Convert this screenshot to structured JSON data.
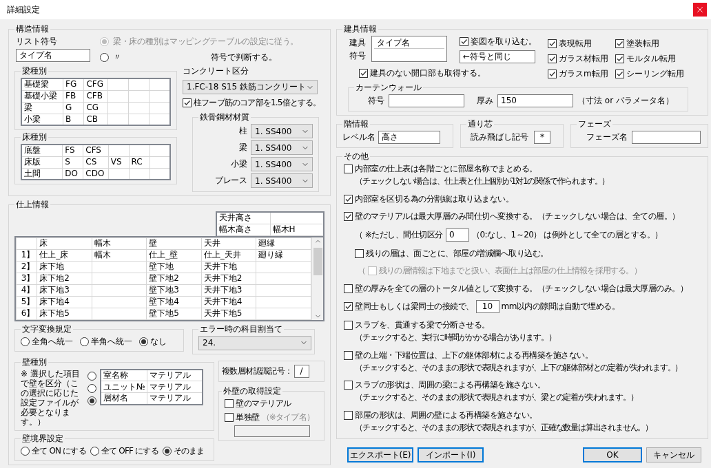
{
  "window": {
    "title": "詳細設定"
  },
  "structure": {
    "title": "構造情報",
    "list_symbol": {
      "label": "リスト符号",
      "value": "タイプ名"
    },
    "mapping_options": [
      {
        "label": "梁・床の種別はマッピングテーブルの設定に従う。",
        "selected": true,
        "disabled": true
      },
      {
        "prefix": "〃",
        "label": "符号で判断する。",
        "selected": false,
        "disabled": false
      }
    ],
    "beam_types": {
      "title": "梁種別",
      "rows": [
        [
          "基礎梁",
          "FG",
          "CFG"
        ],
        [
          "基礎小梁",
          "FB",
          "CFB"
        ],
        [
          "梁",
          "G",
          "CG"
        ],
        [
          "小梁",
          "B",
          "CB"
        ]
      ]
    },
    "floor_types": {
      "title": "床種別",
      "rows": [
        [
          "底盤",
          "FS",
          "CFS"
        ],
        [
          "床版",
          "S",
          "CS",
          "VS",
          "RC"
        ],
        [
          "土間",
          "DO",
          "CDO"
        ]
      ]
    },
    "concrete": {
      "label": "コンクリート区分",
      "value": "1.FC-18 S15 鉄筋コンクリート"
    },
    "hoop": {
      "label": "柱フープ筋のコア部を1.5倍とする。",
      "checked": true
    },
    "steel": {
      "title": "鉄骨鋼材材質",
      "rows": [
        {
          "label": "柱",
          "value": "1. SS400"
        },
        {
          "label": "梁",
          "value": "1. SS400"
        },
        {
          "label": "小梁",
          "value": "1. SS400"
        },
        {
          "label": "ブレース",
          "value": "1. SS400"
        }
      ]
    }
  },
  "finish": {
    "title": "仕上情報",
    "heights": [
      {
        "label": "天井高さ"
      },
      {
        "label": "幅木高さ",
        "value": "幅木H"
      }
    ],
    "columns": [
      "床",
      "幅木",
      "壁",
      "天井",
      "廻縁"
    ],
    "rows": [
      {
        "index": "1】",
        "cells": [
          "仕上_床",
          "幅木",
          "仕上_壁",
          "仕上_天井",
          "廻り縁"
        ]
      },
      {
        "index": "2】",
        "cells": [
          "床下地",
          null,
          "壁下地",
          "天井下地",
          null
        ]
      },
      {
        "index": "3】",
        "cells": [
          "床下地2",
          null,
          "壁下地2",
          "天井下地2",
          null
        ]
      },
      {
        "index": "4】",
        "cells": [
          "床下地3",
          null,
          "壁下地3",
          "天井下地3",
          null
        ]
      },
      {
        "index": "5】",
        "cells": [
          "床下地4",
          null,
          "壁下地4",
          "天井下地4",
          null
        ]
      },
      {
        "index": "6】",
        "cells": [
          "床下地5",
          null,
          "壁下地5",
          "天井下地5",
          null
        ]
      }
    ],
    "char_conversion": {
      "title": "文字変換規定",
      "options": [
        {
          "label": "全角へ統一",
          "selected": false
        },
        {
          "label": "半角へ統一",
          "selected": false
        },
        {
          "label": "なし",
          "selected": true
        }
      ]
    },
    "error_subject": {
      "title": "エラー時の科目割当て",
      "value": "24."
    },
    "wall_types": {
      "title": "壁種別",
      "note": "※ 選択した項目で壁を区分（この選択に応じた設定ファイルが必要となります。）",
      "rows": [
        {
          "name": "室名称",
          "value": "マテリアル",
          "selected": false
        },
        {
          "name": "ユニット№",
          "value": "マテリアル",
          "selected": false
        },
        {
          "name": "層材名",
          "value": "マテリアル",
          "selected": true
        }
      ]
    },
    "multi_layer": {
      "label": "複数層材認識記号：",
      "value": "/"
    },
    "exterior": {
      "title": "外壁の取得設定",
      "options": [
        {
          "label": "壁のマテリアル",
          "checked": false
        },
        {
          "label": "単独壁",
          "hint": "（※タイプ名）",
          "checked": false
        }
      ]
    },
    "wall_boundary": {
      "title": "壁境界設定",
      "options": [
        {
          "label": "全て ON にする",
          "selected": false
        },
        {
          "label": "全て OFF にする",
          "selected": false
        },
        {
          "label": "そのまま",
          "selected": true
        }
      ]
    }
  },
  "fittings": {
    "title": "建具情報",
    "symbol_labels": [
      "建具",
      "符号"
    ],
    "symbol_entries": [
      "タイプ名"
    ],
    "elevation": {
      "label": "姿図を取り込む。",
      "checked": true,
      "value": "←符号と同じ"
    },
    "openings": {
      "label": "建具のない開口部も取得する。",
      "checked": true
    },
    "transfers": [
      {
        "label": "表現転用",
        "checked": true
      },
      {
        "label": "塗装転用",
        "checked": true
      },
      {
        "label": "ガラス材転用",
        "checked": true
      },
      {
        "label": "モルタル転用",
        "checked": true
      },
      {
        "label": "ガラスm転用",
        "checked": true
      },
      {
        "label": "シーリング転用",
        "checked": true
      }
    ],
    "curtain_wall": {
      "title": "カーテンウォール",
      "symbol_label": "符号",
      "thickness_label": "厚み",
      "thickness": "150",
      "note": "（寸法 or パラメータ名）"
    }
  },
  "level": {
    "title": "階情報",
    "label": "レベル名",
    "value": "高さ"
  },
  "grid": {
    "title": "通り芯",
    "label": "読み飛ばし記号",
    "value": "*"
  },
  "phase": {
    "title": "フェーズ",
    "label": "フェーズ名"
  },
  "other": {
    "title": "その他",
    "items": [
      {
        "kind": "check",
        "checked": false,
        "label": "内部室の仕上表は各階ごとに部屋名称でまとめる。",
        "note": "（チェックしない場合は、仕上表と仕上個別が1対1の関係で作られます。）"
      },
      {
        "kind": "check",
        "checked": true,
        "label": "内部室を区切る為の分割線は取り込まない。"
      },
      {
        "kind": "check",
        "checked": true,
        "label": "壁のマテリアルは最大厚層のみ間仕切へ変換する。（チェックしない場合は、全ての層。）"
      },
      {
        "kind": "field_line",
        "prefix": "（ ※ただし、間仕切区分",
        "value": "0",
        "suffix": "（0:なし、1～20） は例外として全ての層とする。）"
      },
      {
        "kind": "subcheck",
        "checked": false,
        "label": "残りの層は、面ごとに、部屋の増減欄へ取り込む。"
      },
      {
        "kind": "disabled_check",
        "open": "（",
        "checked": false,
        "label": "残りの層情報は下地までと扱い、表面仕上は部屋の仕上情報を採用する。）"
      },
      {
        "kind": "check",
        "checked": false,
        "label": "壁の厚みを全ての層のトータル値として変換する。（チェックしない場合は最大厚層のみ。）"
      },
      {
        "kind": "check_field",
        "checked": true,
        "prefix": "壁同士もしくは梁同士の接続で、",
        "value": "10",
        "suffix": "mm以内の隙間は自動で埋める。"
      },
      {
        "kind": "check",
        "checked": false,
        "label": "スラブを、貫通する梁で分断させる。",
        "note": "（チェックすると、実行に時間がかかる場合があります。）"
      },
      {
        "kind": "check",
        "checked": false,
        "label": "壁の上端・下端位置は、上下の躯体部材による再構築を施さない。",
        "note": "（チェックすると、そのままの形状で表現されますが、上下の躯体部材との定着が失われます。）"
      },
      {
        "kind": "check",
        "checked": false,
        "label": "スラブの形状は、周囲の梁による再構築を施さない。",
        "note": "（チェックすると、そのままの形状で表現されますが、梁との定着が失われます。）"
      },
      {
        "kind": "check",
        "checked": false,
        "label": "部屋の形状は、周囲の壁による再構築を施さない。",
        "note": "（チェックすると、そのままの形状で表現されますが、正確な数量は算出されません。）"
      }
    ]
  },
  "buttons": [
    {
      "label": "エクスポート(E)",
      "default": true
    },
    {
      "label": "インポート(I)",
      "default": true
    },
    {
      "label": "OK",
      "default": true
    },
    {
      "label": "キャンセル",
      "default": false
    }
  ]
}
